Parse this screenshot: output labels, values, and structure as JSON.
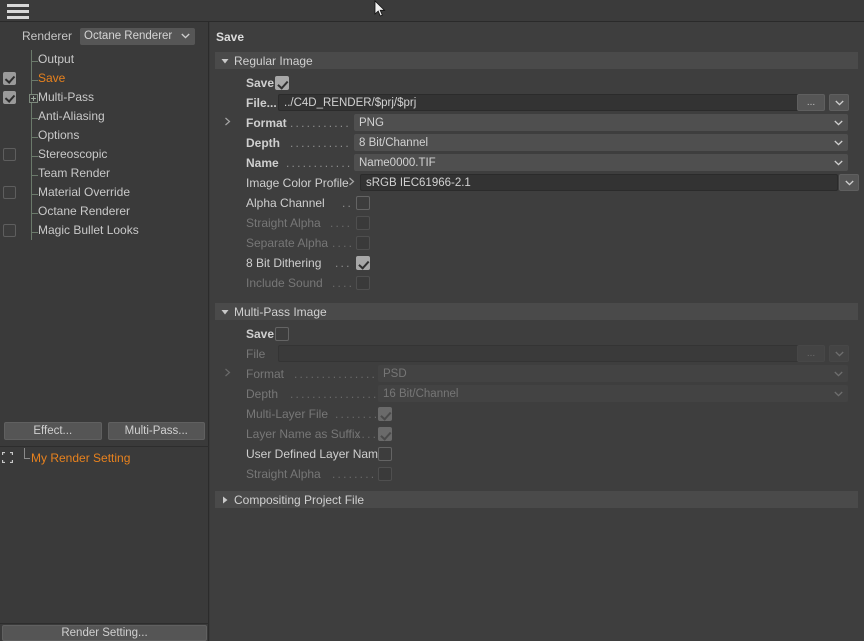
{
  "topbar": {
    "menu_icon": "hamburger-icon"
  },
  "left": {
    "renderer_label": "Renderer",
    "renderer_value": "Octane Renderer",
    "tree": [
      {
        "label": "Output",
        "checkbox": "none",
        "selected": false,
        "expandable": false
      },
      {
        "label": "Save",
        "checkbox": "checked",
        "selected": true,
        "expandable": false
      },
      {
        "label": "Multi-Pass",
        "checkbox": "checked",
        "selected": false,
        "expandable": true
      },
      {
        "label": "Anti-Aliasing",
        "checkbox": "none",
        "selected": false,
        "expandable": false
      },
      {
        "label": "Options",
        "checkbox": "none",
        "selected": false,
        "expandable": false
      },
      {
        "label": "Stereoscopic",
        "checkbox": "unchecked",
        "selected": false,
        "expandable": false
      },
      {
        "label": "Team Render",
        "checkbox": "none",
        "selected": false,
        "expandable": false
      },
      {
        "label": "Material Override",
        "checkbox": "unchecked",
        "selected": false,
        "expandable": false
      },
      {
        "label": "Octane Renderer",
        "checkbox": "none",
        "selected": false,
        "expandable": false
      },
      {
        "label": "Magic Bullet Looks",
        "checkbox": "unchecked",
        "selected": false,
        "expandable": false
      }
    ],
    "effect_button": "Effect...",
    "multipass_button": "Multi-Pass...",
    "my_render_setting": "My Render Setting",
    "render_setting_button": "Render Setting..."
  },
  "right": {
    "title": "Save",
    "regular_image": {
      "header": "Regular Image",
      "expanded": true,
      "save_label": "Save",
      "save_checked": true,
      "file_label": "File...",
      "file_value": "../C4D_RENDER/$prj/$prj",
      "browse_button": "...",
      "format_label": "Format",
      "format_value": "PNG",
      "depth_label": "Depth",
      "depth_value": "8 Bit/Channel",
      "name_label": "Name",
      "name_value": "Name0000.TIF",
      "color_profile_label": "Image Color Profile",
      "color_profile_value": "sRGB IEC61966-2.1",
      "alpha_channel_label": "Alpha Channel",
      "alpha_channel_checked": false,
      "straight_alpha_label": "Straight Alpha",
      "straight_alpha_checked": false,
      "separate_alpha_label": "Separate Alpha",
      "separate_alpha_checked": false,
      "dithering_label": "8 Bit Dithering",
      "dithering_checked": true,
      "include_sound_label": "Include Sound",
      "include_sound_checked": false
    },
    "multi_pass_image": {
      "header": "Multi-Pass Image",
      "expanded": true,
      "save_label": "Save",
      "save_checked": false,
      "file_label": "File",
      "file_value": "",
      "browse_button": "...",
      "format_label": "Format",
      "format_value": "PSD",
      "depth_label": "Depth",
      "depth_value": "16 Bit/Channel",
      "multilayer_label": "Multi-Layer File",
      "multilayer_checked": true,
      "layer_suffix_label": "Layer Name as Suffix",
      "layer_suffix_checked": true,
      "user_layer_label": "User Defined Layer Name",
      "user_layer_checked": false,
      "straight_alpha_label": "Straight Alpha",
      "straight_alpha_checked": false
    },
    "compositing": {
      "header": "Compositing Project File",
      "expanded": false
    }
  },
  "colors": {
    "accent_orange": "#e8821e",
    "panel_bg": "#3e3e3e",
    "sidebar_bg": "#3a3a3a",
    "group_header_bg": "#4a4a4a"
  }
}
